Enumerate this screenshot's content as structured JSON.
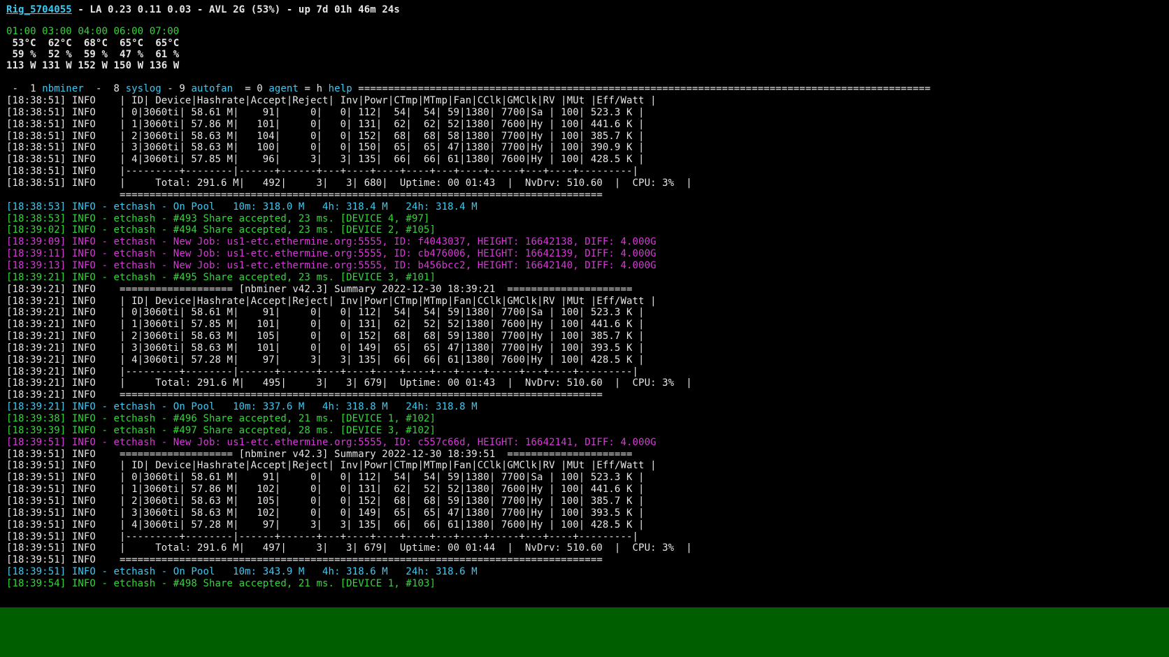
{
  "colors": {
    "background": "#000000",
    "text": "#e6e6e6",
    "cyan": "#3fc8f0",
    "green": "#33d63a",
    "magenta": "#d63ad6",
    "status_bar": "#005e00"
  },
  "status": {
    "rig_name": "Rig_5704055",
    "rest": " - LA 0.23 0.11 0.03 - AVL 2G (53%) - up 7d 01h 46m 24s"
  },
  "gpu_stats": {
    "times": "01:00 03:00 04:00 06:00 07:00",
    "temps": " 53°C  62°C  68°C  65°C  65°C",
    "fans": " 59 %  52 %  59 %  47 %  61 %",
    "power": "113 W 131 W 152 W 150 W 136 W"
  },
  "menu": {
    "sep1": " -  1 ",
    "nbminer": "nbminer",
    "sep2": "  -  8 ",
    "syslog": "syslog",
    "sep3": " - 9 ",
    "autofan": "autofan",
    "sep4": "  = 0 ",
    "agent": "agent",
    "sep5": " = h ",
    "help": "help",
    "sep6": " ================================================================================================"
  },
  "log": [
    {
      "t": "[18:38:51] INFO    | ID| Device|Hashrate|Accept|Reject| Inv|Powr|CTmp|MTmp|Fan|CClk|GMClk|RV |MUt |Eff/Watt |",
      "c": "white"
    },
    {
      "t": "[18:38:51] INFO    | 0|3060ti| 58.61 M|    91|     0|   0| 112|  54|  54| 59|1380| 7700|Sa | 100| 523.3 K |",
      "c": "white"
    },
    {
      "t": "[18:38:51] INFO    | 1|3060ti| 57.86 M|   101|     0|   0| 131|  62|  62| 52|1380| 7600|Hy | 100| 441.6 K |",
      "c": "white"
    },
    {
      "t": "[18:38:51] INFO    | 2|3060ti| 58.63 M|   104|     0|   0| 152|  68|  68| 58|1380| 7700|Hy | 100| 385.7 K |",
      "c": "white"
    },
    {
      "t": "[18:38:51] INFO    | 3|3060ti| 58.63 M|   100|     0|   0| 150|  65|  65| 47|1380| 7700|Hy | 100| 390.9 K |",
      "c": "white"
    },
    {
      "t": "[18:38:51] INFO    | 4|3060ti| 57.85 M|    96|     3|   3| 135|  66|  66| 61|1380| 7600|Hy | 100| 428.5 K |",
      "c": "white"
    },
    {
      "t": "[18:38:51] INFO    |---------+--------|------+------+---+----+----+----+---+----+-----+---+----+---------|",
      "c": "white"
    },
    {
      "t": "[18:38:51] INFO    |     Total: 291.6 M|   492|     3|   3| 680|  Uptime: 00 01:43  |  NvDrv: 510.60  |  CPU: 3%  |",
      "c": "white"
    },
    {
      "t": "                   =================================================================================",
      "c": "white"
    },
    {
      "t": "[18:38:53] INFO - etchash - On Pool   10m: 318.0 M   4h: 318.4 M   24h: 318.4 M",
      "c": "cyan"
    },
    {
      "t": "[18:38:53] INFO - etchash - #493 Share accepted, 23 ms. [DEVICE 4, #97]",
      "c": "green"
    },
    {
      "t": "[18:39:02] INFO - etchash - #494 Share accepted, 23 ms. [DEVICE 2, #105]",
      "c": "green"
    },
    {
      "t": "[18:39:09] INFO - etchash - New Job: us1-etc.ethermine.org:5555, ID: f4043037, HEIGHT: 16642138, DIFF: 4.000G",
      "c": "magenta"
    },
    {
      "t": "[18:39:11] INFO - etchash - New Job: us1-etc.ethermine.org:5555, ID: cb476006, HEIGHT: 16642139, DIFF: 4.000G",
      "c": "magenta"
    },
    {
      "t": "[18:39:13] INFO - etchash - New Job: us1-etc.ethermine.org:5555, ID: b456bcc2, HEIGHT: 16642140, DIFF: 4.000G",
      "c": "magenta"
    },
    {
      "t": "[18:39:21] INFO - etchash - #495 Share accepted, 23 ms. [DEVICE 3, #101]",
      "c": "green"
    },
    {
      "t": "[18:39:21] INFO    =================== [nbminer v42.3] Summary 2022-12-30 18:39:21  =====================",
      "c": "white"
    },
    {
      "t": "[18:39:21] INFO    | ID| Device|Hashrate|Accept|Reject| Inv|Powr|CTmp|MTmp|Fan|CClk|GMClk|RV |MUt |Eff/Watt |",
      "c": "white"
    },
    {
      "t": "[18:39:21] INFO    | 0|3060ti| 58.61 M|    91|     0|   0| 112|  54|  54| 59|1380| 7700|Sa | 100| 523.3 K |",
      "c": "white"
    },
    {
      "t": "[18:39:21] INFO    | 1|3060ti| 57.85 M|   101|     0|   0| 131|  62|  52| 52|1380| 7600|Hy | 100| 441.6 K |",
      "c": "white"
    },
    {
      "t": "[18:39:21] INFO    | 2|3060ti| 58.63 M|   105|     0|   0| 152|  68|  68| 59|1380| 7700|Hy | 100| 385.7 K |",
      "c": "white"
    },
    {
      "t": "[18:39:21] INFO    | 3|3060ti| 58.63 M|   101|     0|   0| 149|  65|  65| 47|1380| 7700|Hy | 100| 393.5 K |",
      "c": "white"
    },
    {
      "t": "[18:39:21] INFO    | 4|3060ti| 57.28 M|    97|     3|   3| 135|  66|  66| 61|1380| 7600|Hy | 100| 428.5 K |",
      "c": "white"
    },
    {
      "t": "[18:39:21] INFO    |---------+--------|------+------+---+----+----+----+---+----+-----+---+----+---------|",
      "c": "white"
    },
    {
      "t": "[18:39:21] INFO    |     Total: 291.6 M|   495|     3|   3| 679|  Uptime: 00 01:43  |  NvDrv: 510.60  |  CPU: 3%  |",
      "c": "white"
    },
    {
      "t": "[18:39:21] INFO    =================================================================================",
      "c": "white"
    },
    {
      "t": "[18:39:21] INFO - etchash - On Pool   10m: 337.6 M   4h: 318.8 M   24h: 318.8 M",
      "c": "cyan"
    },
    {
      "t": "[18:39:38] INFO - etchash - #496 Share accepted, 21 ms. [DEVICE 1, #102]",
      "c": "green"
    },
    {
      "t": "[18:39:39] INFO - etchash - #497 Share accepted, 28 ms. [DEVICE 3, #102]",
      "c": "green"
    },
    {
      "t": "[18:39:51] INFO - etchash - New Job: us1-etc.ethermine.org:5555, ID: c557c66d, HEIGHT: 16642141, DIFF: 4.000G",
      "c": "magenta"
    },
    {
      "t": "[18:39:51] INFO    =================== [nbminer v42.3] Summary 2022-12-30 18:39:51  =====================",
      "c": "white"
    },
    {
      "t": "[18:39:51] INFO    | ID| Device|Hashrate|Accept|Reject| Inv|Powr|CTmp|MTmp|Fan|CClk|GMClk|RV |MUt |Eff/Watt |",
      "c": "white"
    },
    {
      "t": "[18:39:51] INFO    | 0|3060ti| 58.61 M|    91|     0|   0| 112|  54|  54| 59|1380| 7700|Sa | 100| 523.3 K |",
      "c": "white"
    },
    {
      "t": "[18:39:51] INFO    | 1|3060ti| 57.86 M|   102|     0|   0| 131|  62|  52| 52|1380| 7600|Hy | 100| 441.6 K |",
      "c": "white"
    },
    {
      "t": "[18:39:51] INFO    | 2|3060ti| 58.63 M|   105|     0|   0| 152|  68|  68| 59|1380| 7700|Hy | 100| 385.7 K |",
      "c": "white"
    },
    {
      "t": "[18:39:51] INFO    | 3|3060ti| 58.63 M|   102|     0|   0| 149|  65|  65| 47|1380| 7700|Hy | 100| 393.5 K |",
      "c": "white"
    },
    {
      "t": "[18:39:51] INFO    | 4|3060ti| 57.28 M|    97|     3|   3| 135|  66|  66| 61|1380| 7600|Hy | 100| 428.5 K |",
      "c": "white"
    },
    {
      "t": "[18:39:51] INFO    |---------+--------|------+------+---+----+----+----+---+----+-----+---+----+---------|",
      "c": "white"
    },
    {
      "t": "[18:39:51] INFO    |     Total: 291.6 M|   497|     3|   3| 679|  Uptime: 00 01:44  |  NvDrv: 510.60  |  CPU: 3%  |",
      "c": "white"
    },
    {
      "t": "[18:39:51] INFO    =================================================================================",
      "c": "white"
    },
    {
      "t": "[18:39:51] INFO - etchash - On Pool   10m: 343.9 M   4h: 318.6 M   24h: 318.6 M",
      "c": "cyan"
    },
    {
      "t": "[18:39:54] INFO - etchash - #498 Share accepted, 21 ms. [DEVICE 1, #103]",
      "c": "green"
    }
  ]
}
